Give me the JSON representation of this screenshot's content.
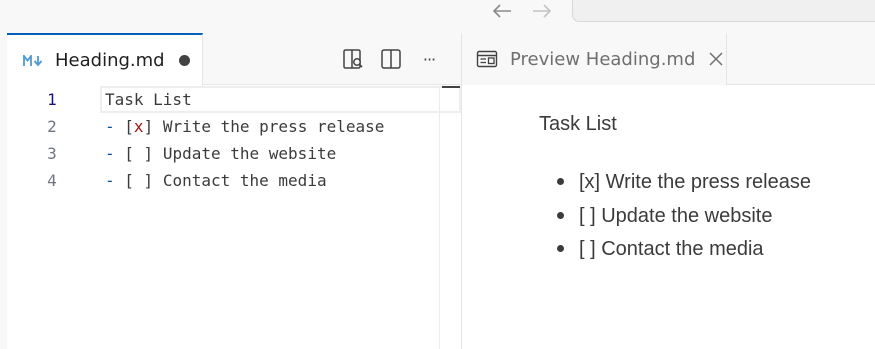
{
  "titlebar": {
    "back_icon": "arrow-left-icon",
    "forward_icon": "arrow-right-icon"
  },
  "left_group": {
    "tab": {
      "icon": "markdown-icon",
      "label": "Heading.md",
      "dirty": true
    },
    "actions": [
      {
        "name": "open-preview-to-side-button",
        "icon": "preview-search-icon"
      },
      {
        "name": "split-editor-button",
        "icon": "split-editor-icon"
      },
      {
        "name": "more-actions-button",
        "icon": "ellipsis-icon",
        "glyph": "···"
      }
    ],
    "lines": [
      {
        "num": "1",
        "text": "Task List"
      },
      {
        "num": "2",
        "dash": "-",
        "box": "[x]",
        "rest": " Write the press release"
      },
      {
        "num": "3",
        "dash": "-",
        "box": "[ ]",
        "rest": " Update the website"
      },
      {
        "num": "4",
        "dash": "-",
        "box": "[ ]",
        "rest": " Contact the media"
      }
    ]
  },
  "right_group": {
    "tab": {
      "icon": "preview-icon",
      "label": "Preview Heading.md",
      "close_icon": "close-icon"
    },
    "preview": {
      "title": "Task List",
      "items": [
        "[x] Write the press release",
        "[ ] Update the website",
        "[ ] Contact the media"
      ]
    }
  },
  "colors": {
    "accent": "#005fb8",
    "markdown_icon": "#4a9ad6",
    "list_marker": "#0451a5",
    "checked_x": "#a31515",
    "line_number_active": "#171184"
  }
}
